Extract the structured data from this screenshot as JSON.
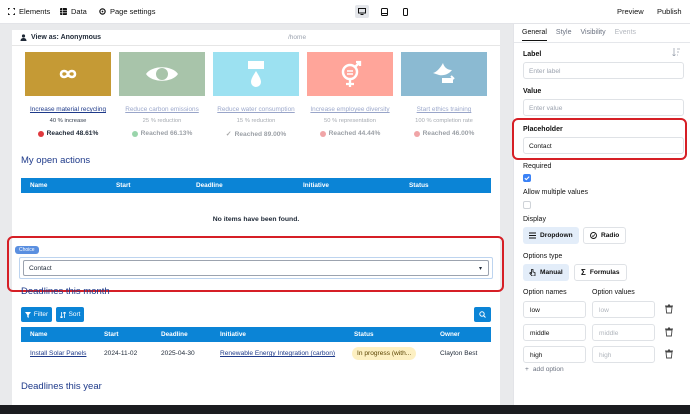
{
  "toolbar": {
    "elements": "Elements",
    "data": "Data",
    "page_settings": "Page settings",
    "preview": "Preview",
    "publish": "Publish"
  },
  "view_as": {
    "label": "View as: Anonymous",
    "path": "/home"
  },
  "goals": [
    {
      "name": "Increase material recycling",
      "sub": "40 % increase",
      "reached": "Reached 48.61%",
      "color": "#c59a35",
      "status": "red",
      "faded": false
    },
    {
      "name": "Reduce carbon emissions",
      "sub": "25 % reduction",
      "reached": "Reached 66.13%",
      "color": "#3f7e44",
      "status": "green",
      "faded": true
    },
    {
      "name": "Reduce water consumption",
      "sub": "15 % reduction",
      "reached": "Reached 89.00%",
      "color": "#26bde2",
      "status": "check",
      "faded": true
    },
    {
      "name": "Increase employee diversity",
      "sub": "50 % representation",
      "reached": "Reached 44.44%",
      "color": "#ff3a21",
      "status": "red",
      "faded": true
    },
    {
      "name": "Start ethics training",
      "sub": "100 % completion rate",
      "reached": "Reached 46.00%",
      "color": "#00689d",
      "status": "red",
      "faded": true
    }
  ],
  "open_actions": {
    "title": "My open actions",
    "columns": [
      "Name",
      "Start",
      "Deadline",
      "Initiative",
      "Status"
    ],
    "empty": "No items have been found."
  },
  "choice": {
    "tag": "Choice",
    "value": "Contact"
  },
  "deadlines_month": {
    "title": "Deadlines this month",
    "filter": "Filter",
    "sort": "Sort",
    "columns": [
      "Name",
      "Start",
      "Deadline",
      "Initiative",
      "Status",
      "Owner"
    ],
    "row": {
      "name": "Install Solar Panels",
      "start": "2024-11-02",
      "deadline": "2025-04-30",
      "initiative": "Renewable Energy Integration (carbon)",
      "status": "In progress (with...",
      "owner": "Clayton Best"
    }
  },
  "deadlines_year": {
    "title": "Deadlines this year"
  },
  "panel": {
    "tabs": [
      "General",
      "Style",
      "Visibility",
      "Events"
    ],
    "label": {
      "title": "Label",
      "placeholder": "Enter label"
    },
    "value": {
      "title": "Value",
      "placeholder": "Enter value"
    },
    "placeholder": {
      "title": "Placeholder",
      "value": "Contact"
    },
    "required": "Required",
    "allow_multiple": "Allow multiple values",
    "display": {
      "title": "Display",
      "dropdown": "Dropdown",
      "radio": "Radio"
    },
    "options_type": {
      "title": "Options type",
      "manual": "Manual",
      "formulas": "Formulas"
    },
    "option_names_title": "Option names",
    "option_values_title": "Option values",
    "options": [
      {
        "name": "low",
        "value": "low"
      },
      {
        "name": "middle",
        "value": "middle"
      },
      {
        "name": "high",
        "value": "high"
      }
    ],
    "add_option": "add option"
  },
  "colors": {
    "accent": "#0b84d6",
    "highlight": "#d61f26",
    "heading": "#1e3a8a"
  }
}
